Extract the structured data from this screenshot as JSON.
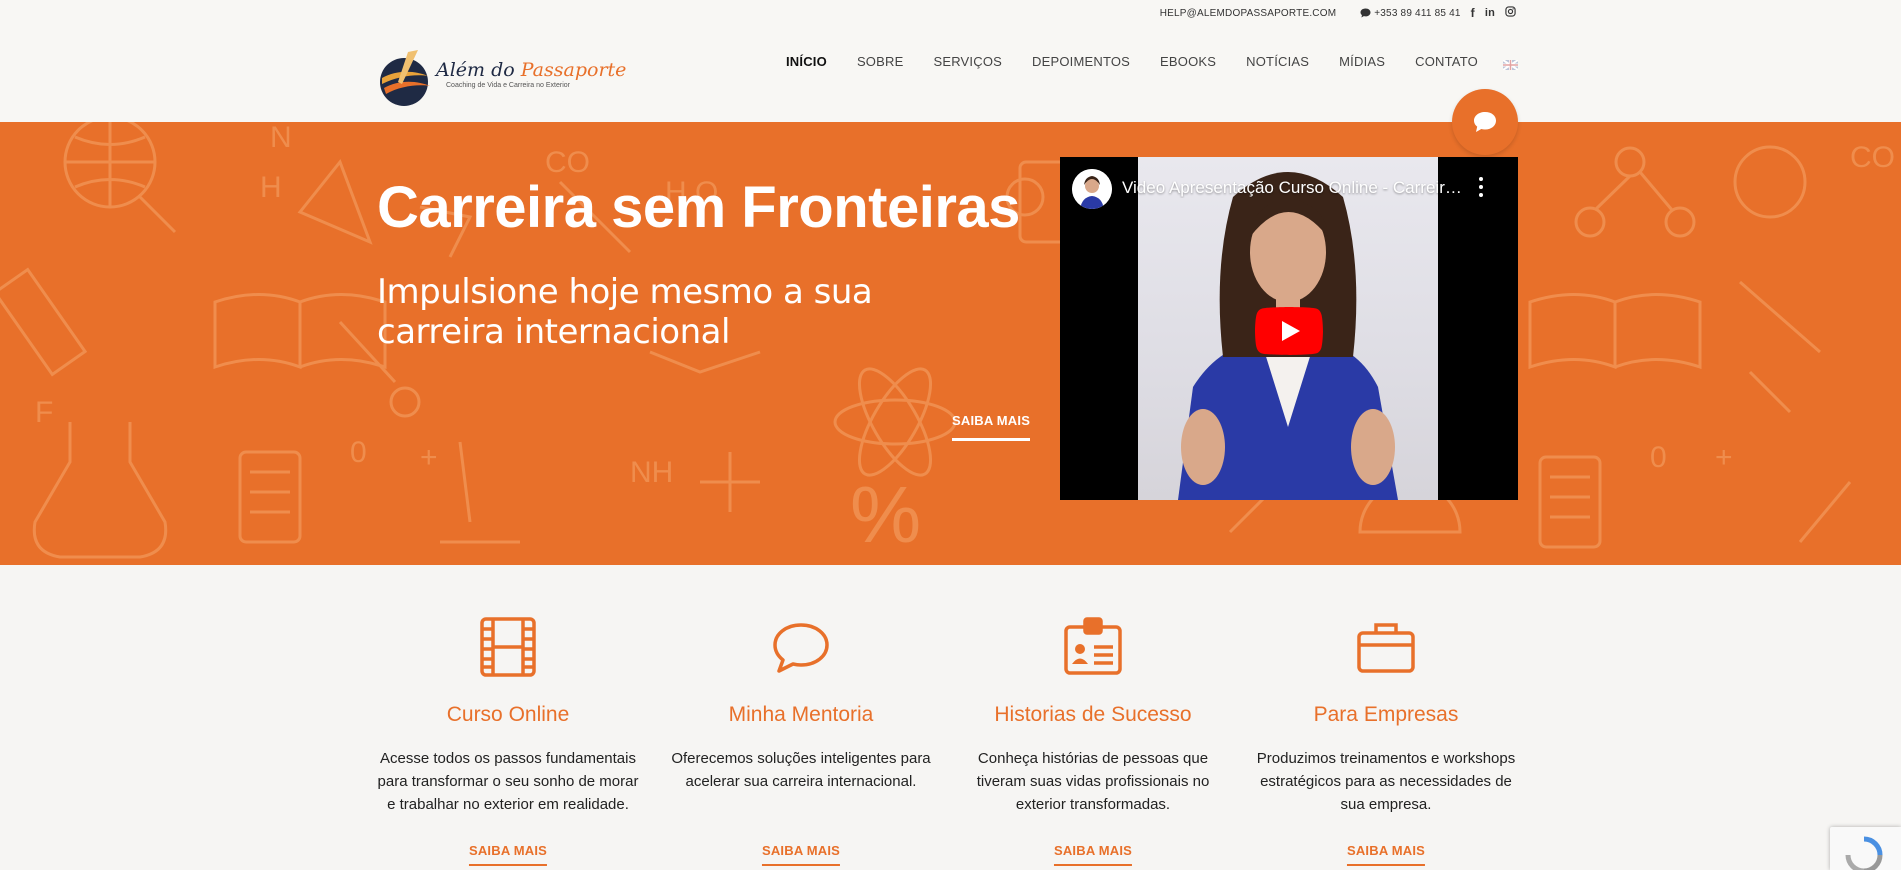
{
  "topbar": {
    "email": "HELP@ALEMDOPASSAPORTE.COM",
    "phone": "+353 89 411 85 41",
    "social": [
      "facebook-icon",
      "linkedin-icon",
      "instagram-icon"
    ]
  },
  "brand": {
    "title_part1": "Além do ",
    "title_part2": "Passaporte",
    "tagline": "Coaching de Vida e Carreira no Exterior"
  },
  "nav": {
    "items": [
      "INÍCIO",
      "SOBRE",
      "SERVIÇOS",
      "DEPOIMENTOS",
      "EBOOKS",
      "NOTÍCIAS",
      "MÍDIAS",
      "CONTATO"
    ],
    "active": "INÍCIO",
    "language_flag": "uk-flag-icon"
  },
  "hero": {
    "title": "Carreira sem Fronteiras",
    "subtitle": "Impulsione hoje mesmo a sua carreira internacional",
    "cta": "SAIBA MAIS",
    "video_title": "Video Apresentação Curso Online - Carreira sem Fronteiras"
  },
  "features": [
    {
      "icon": "film-icon",
      "title": "Curso Online",
      "desc": "Acesse todos os passos fundamentais para transformar o seu sonho de morar e trabalhar no exterior em realidade.",
      "cta": "SAIBA MAIS"
    },
    {
      "icon": "speech-bubble-icon",
      "title": "Minha Mentoria",
      "desc": "Oferecemos  soluções inteligentes para acelerar sua carreira internacional.",
      "cta": "SAIBA MAIS"
    },
    {
      "icon": "id-badge-icon",
      "title": "Historias de Sucesso",
      "desc": "Conheça histórias de pessoas que tiveram suas vidas profissionais no exterior transformadas.",
      "cta": "SAIBA MAIS"
    },
    {
      "icon": "briefcase-icon",
      "title": "Para Empresas",
      "desc": "Produzimos treinamentos e workshops estratégicos para as necessidades de sua empresa.",
      "cta": "SAIBA MAIS"
    }
  ],
  "colors": {
    "accent": "#e8702a",
    "navy": "#1f2a44",
    "background": "#f6f5f3"
  }
}
